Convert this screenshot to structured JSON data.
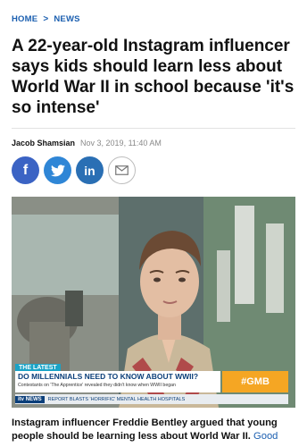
{
  "breadcrumb": {
    "home": "HOME",
    "separator": ">",
    "section": "NEWS"
  },
  "article": {
    "headline": "A 22-year-old Instagram influencer says kids should learn less about World War II in school because 'it's so intense'",
    "author": "Jacob Shamsian",
    "date": "Nov 3, 2019, 11:40 AM"
  },
  "share": {
    "facebook": "f",
    "linkedin": "in",
    "icons": [
      "facebook-icon",
      "twitter-icon",
      "linkedin-icon",
      "email-icon"
    ]
  },
  "photo": {
    "latest_tag": "THE LATEST",
    "banner_title": "DO MILLENNIALS NEED TO KNOW ABOUT WWII?",
    "banner_sub": "Contestants on 'The Apprentice' revealed they didn't know when WWII began",
    "hashtag": "#GMB",
    "ticker_logo": "itv NEWS",
    "ticker_text": "REPORT BLASTS 'HORRIFIC' MENTAL HEALTH HOSPITALS"
  },
  "caption": {
    "text": "Instagram influencer Freddie Bentley argued that young people should be learning less about World War II.",
    "continuation": "Good"
  },
  "colors": {
    "link": "#1b5fb0",
    "facebook": "#3b63c4",
    "twitter": "#2f86d6",
    "linkedin": "#2a6fb4",
    "gmb": "#f5a623"
  }
}
